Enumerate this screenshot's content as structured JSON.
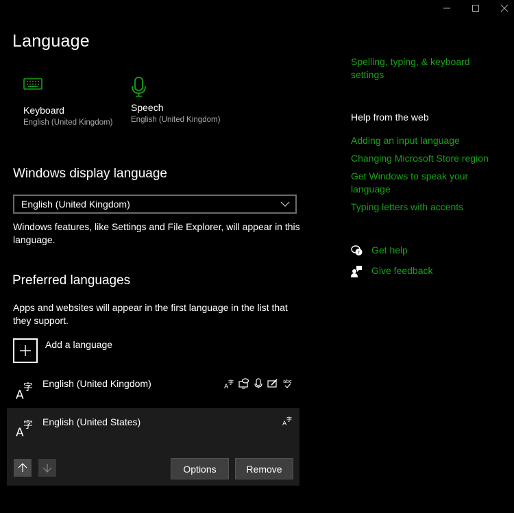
{
  "window": {
    "controls": [
      "minimize",
      "maximize",
      "close"
    ]
  },
  "page": {
    "title": "Language"
  },
  "tiles": [
    {
      "label": "Keyboard",
      "sub": "English (United Kingdom)",
      "icon": "keyboard-icon"
    },
    {
      "label": "Speech",
      "sub": "English (United Kingdom)",
      "icon": "microphone-icon"
    }
  ],
  "display_language": {
    "heading": "Windows display language",
    "selected": "English (United Kingdom)",
    "description": "Windows features, like Settings and File Explorer, will appear in this language."
  },
  "preferred": {
    "heading": "Preferred languages",
    "description": "Apps and websites will appear in the first language in the list that they support.",
    "add_label": "Add a language",
    "languages": [
      {
        "name": "English (United Kingdom)",
        "features": [
          "display-language-icon",
          "text-to-speech-icon",
          "speech-recognition-icon",
          "handwriting-icon",
          "spell-check-icon"
        ]
      },
      {
        "name": "English (United States)",
        "features": [
          "display-language-icon"
        ],
        "selected": true
      }
    ],
    "options_label": "Options",
    "remove_label": "Remove"
  },
  "sidebar": {
    "related_link": "Spelling, typing, & keyboard settings",
    "help_heading": "Help from the web",
    "help_links": [
      "Adding an input language",
      "Changing Microsoft Store region",
      "Get Windows to speak your language",
      "Typing letters with accents"
    ],
    "get_help": "Get help",
    "give_feedback": "Give feedback"
  },
  "colors": {
    "accent": "#16a316",
    "background": "#000000",
    "selected_row": "#1c1c1c"
  }
}
